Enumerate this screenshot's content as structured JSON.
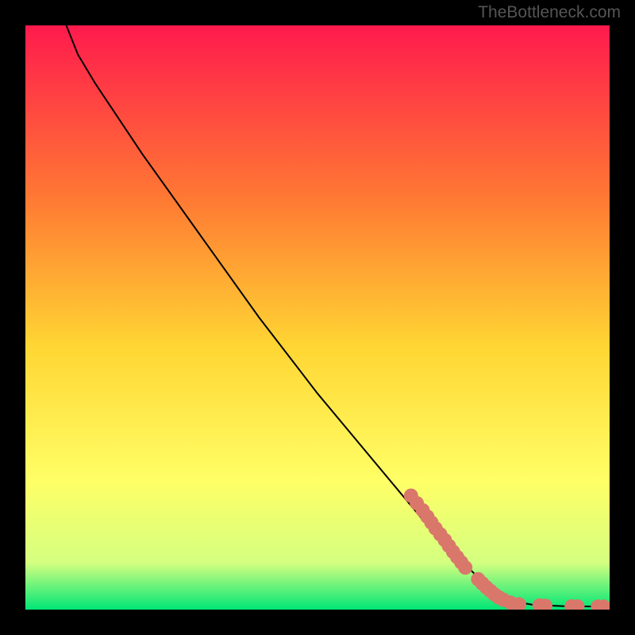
{
  "watermark": "TheBottleneck.com",
  "chart_data": {
    "type": "line",
    "title": "",
    "xlabel": "",
    "ylabel": "",
    "xlim": [
      0,
      100
    ],
    "ylim": [
      0,
      100
    ],
    "gradient_bg": {
      "top": "#ff1a4d",
      "upper_mid": "#ff7a33",
      "mid": "#ffd633",
      "lower_mid": "#ffff66",
      "low": "#d4ff80",
      "bottom": "#00e676"
    },
    "curve": [
      {
        "x": 7,
        "y": 100
      },
      {
        "x": 9,
        "y": 95
      },
      {
        "x": 12,
        "y": 90
      },
      {
        "x": 16,
        "y": 84
      },
      {
        "x": 20,
        "y": 78
      },
      {
        "x": 30,
        "y": 64
      },
      {
        "x": 40,
        "y": 50
      },
      {
        "x": 50,
        "y": 37
      },
      {
        "x": 60,
        "y": 25
      },
      {
        "x": 70,
        "y": 13
      },
      {
        "x": 78,
        "y": 5
      },
      {
        "x": 83,
        "y": 1.5
      },
      {
        "x": 87,
        "y": 0.8
      },
      {
        "x": 92,
        "y": 0.6
      },
      {
        "x": 100,
        "y": 0.5
      }
    ],
    "scatter_points": [
      {
        "x": 66,
        "y": 19.5
      },
      {
        "x": 67,
        "y": 18.2
      },
      {
        "x": 68,
        "y": 17.0
      },
      {
        "x": 68.8,
        "y": 15.9
      },
      {
        "x": 69.5,
        "y": 14.9
      },
      {
        "x": 70.2,
        "y": 13.9
      },
      {
        "x": 71.0,
        "y": 12.9
      },
      {
        "x": 71.8,
        "y": 11.9
      },
      {
        "x": 72.5,
        "y": 10.9
      },
      {
        "x": 73.2,
        "y": 9.9
      },
      {
        "x": 73.9,
        "y": 9.0
      },
      {
        "x": 74.6,
        "y": 8.1
      },
      {
        "x": 75.3,
        "y": 7.2
      },
      {
        "x": 77.5,
        "y": 5.2
      },
      {
        "x": 78.2,
        "y": 4.5
      },
      {
        "x": 78.9,
        "y": 3.8
      },
      {
        "x": 79.6,
        "y": 3.2
      },
      {
        "x": 80.3,
        "y": 2.6
      },
      {
        "x": 81.0,
        "y": 2.1
      },
      {
        "x": 81.8,
        "y": 1.7
      },
      {
        "x": 83.0,
        "y": 1.2
      },
      {
        "x": 84.5,
        "y": 0.9
      },
      {
        "x": 88.0,
        "y": 0.7
      },
      {
        "x": 89.0,
        "y": 0.65
      },
      {
        "x": 93.5,
        "y": 0.55
      },
      {
        "x": 94.5,
        "y": 0.53
      },
      {
        "x": 98.0,
        "y": 0.5
      },
      {
        "x": 99.0,
        "y": 0.5
      }
    ],
    "point_color": "#d9776b",
    "curve_color": "#000000"
  }
}
